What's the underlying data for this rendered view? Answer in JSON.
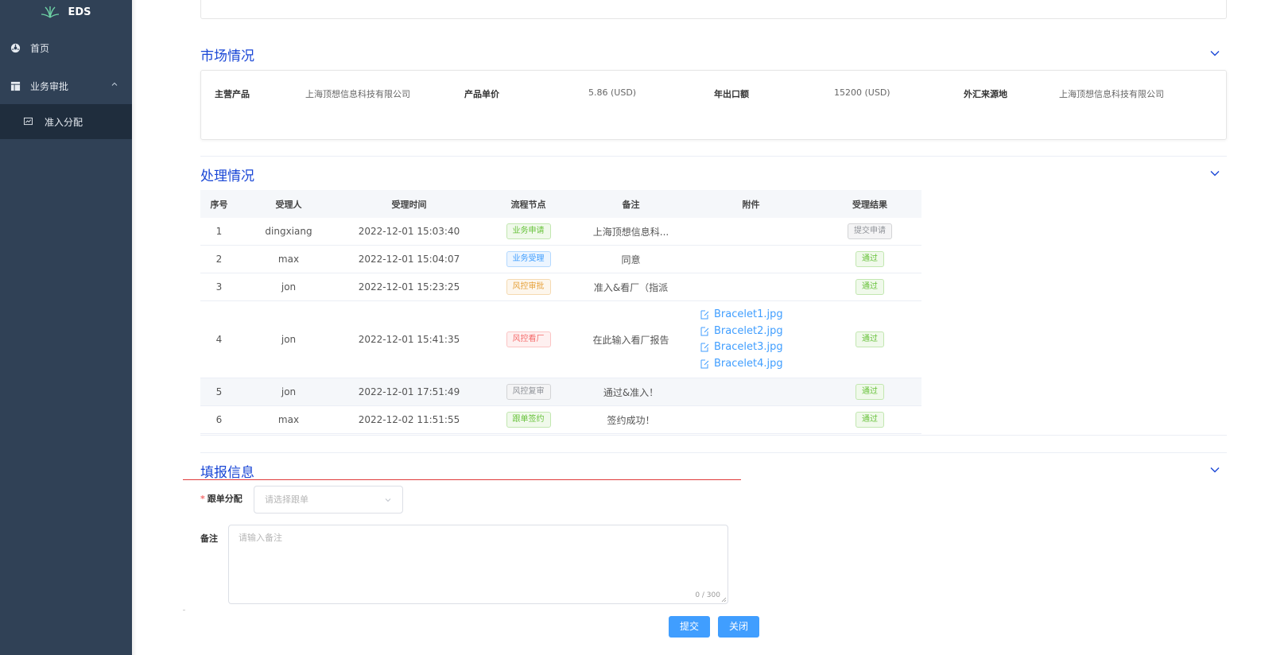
{
  "app": {
    "name": "EDS"
  },
  "sidebar": {
    "items": [
      {
        "label": "首页",
        "icon": "dashboard-icon"
      },
      {
        "label": "业务审批",
        "icon": "table-icon",
        "expanded": true
      }
    ],
    "subitems": [
      {
        "label": "准入分配",
        "icon": "chart-icon",
        "active": true
      }
    ]
  },
  "market": {
    "title": "市场情况",
    "fields": [
      {
        "label": "主营产品",
        "value": "上海顶想信息科技有限公司"
      },
      {
        "label": "产品单价",
        "value": "5.86 (USD)"
      },
      {
        "label": "年出口额",
        "value": "15200 (USD)"
      },
      {
        "label": "外汇来源地",
        "value": "上海顶想信息科技有限公司"
      }
    ]
  },
  "process": {
    "title": "处理情况",
    "columns": [
      "序号",
      "受理人",
      "受理时间",
      "流程节点",
      "备注",
      "附件",
      "受理结果"
    ],
    "rows": [
      {
        "no": "1",
        "handler": "dingxiang",
        "time": "2022-12-01 15:03:40",
        "node": "业务申请",
        "node_color": "green",
        "remark": "上海顶想信息科...",
        "attachments": [],
        "result": "提交申请",
        "result_color": "grey"
      },
      {
        "no": "2",
        "handler": "max",
        "time": "2022-12-01 15:04:07",
        "node": "业务受理",
        "node_color": "blue",
        "remark": "同意",
        "attachments": [],
        "result": "通过",
        "result_color": "green"
      },
      {
        "no": "3",
        "handler": "jon",
        "time": "2022-12-01 15:23:25",
        "node": "风控审批",
        "node_color": "orange",
        "remark": "准入&看厂（指派",
        "attachments": [],
        "result": "通过",
        "result_color": "green"
      },
      {
        "no": "4",
        "handler": "jon",
        "time": "2022-12-01 15:41:35",
        "node": "风控看厂",
        "node_color": "red",
        "remark": "在此输入看厂报告",
        "attachments": [
          "Bracelet1.jpg",
          "Bracelet2.jpg",
          "Bracelet3.jpg",
          "Bracelet4.jpg"
        ],
        "result": "通过",
        "result_color": "green"
      },
      {
        "no": "5",
        "handler": "jon",
        "time": "2022-12-01 17:51:49",
        "node": "风控复审",
        "node_color": "grey",
        "remark": "通过&准入！",
        "attachments": [],
        "result": "通过",
        "result_color": "green"
      },
      {
        "no": "6",
        "handler": "max",
        "time": "2022-12-02 11:51:55",
        "node": "跟单签约",
        "node_color": "green",
        "remark": "签约成功！",
        "attachments": [],
        "result": "通过",
        "result_color": "green"
      }
    ]
  },
  "form": {
    "title": "填报信息",
    "assign_label": "跟单分配",
    "assign_required": "*",
    "assign_placeholder": "请选择跟单",
    "remark_label": "备注",
    "remark_placeholder": "请输入备注",
    "remark_counter": "0 / 300",
    "submit_label": "提交",
    "close_label": "关闭"
  },
  "colors": {
    "sidebar": "#304156",
    "accent": "#409eff",
    "title": "#1a47d6"
  }
}
